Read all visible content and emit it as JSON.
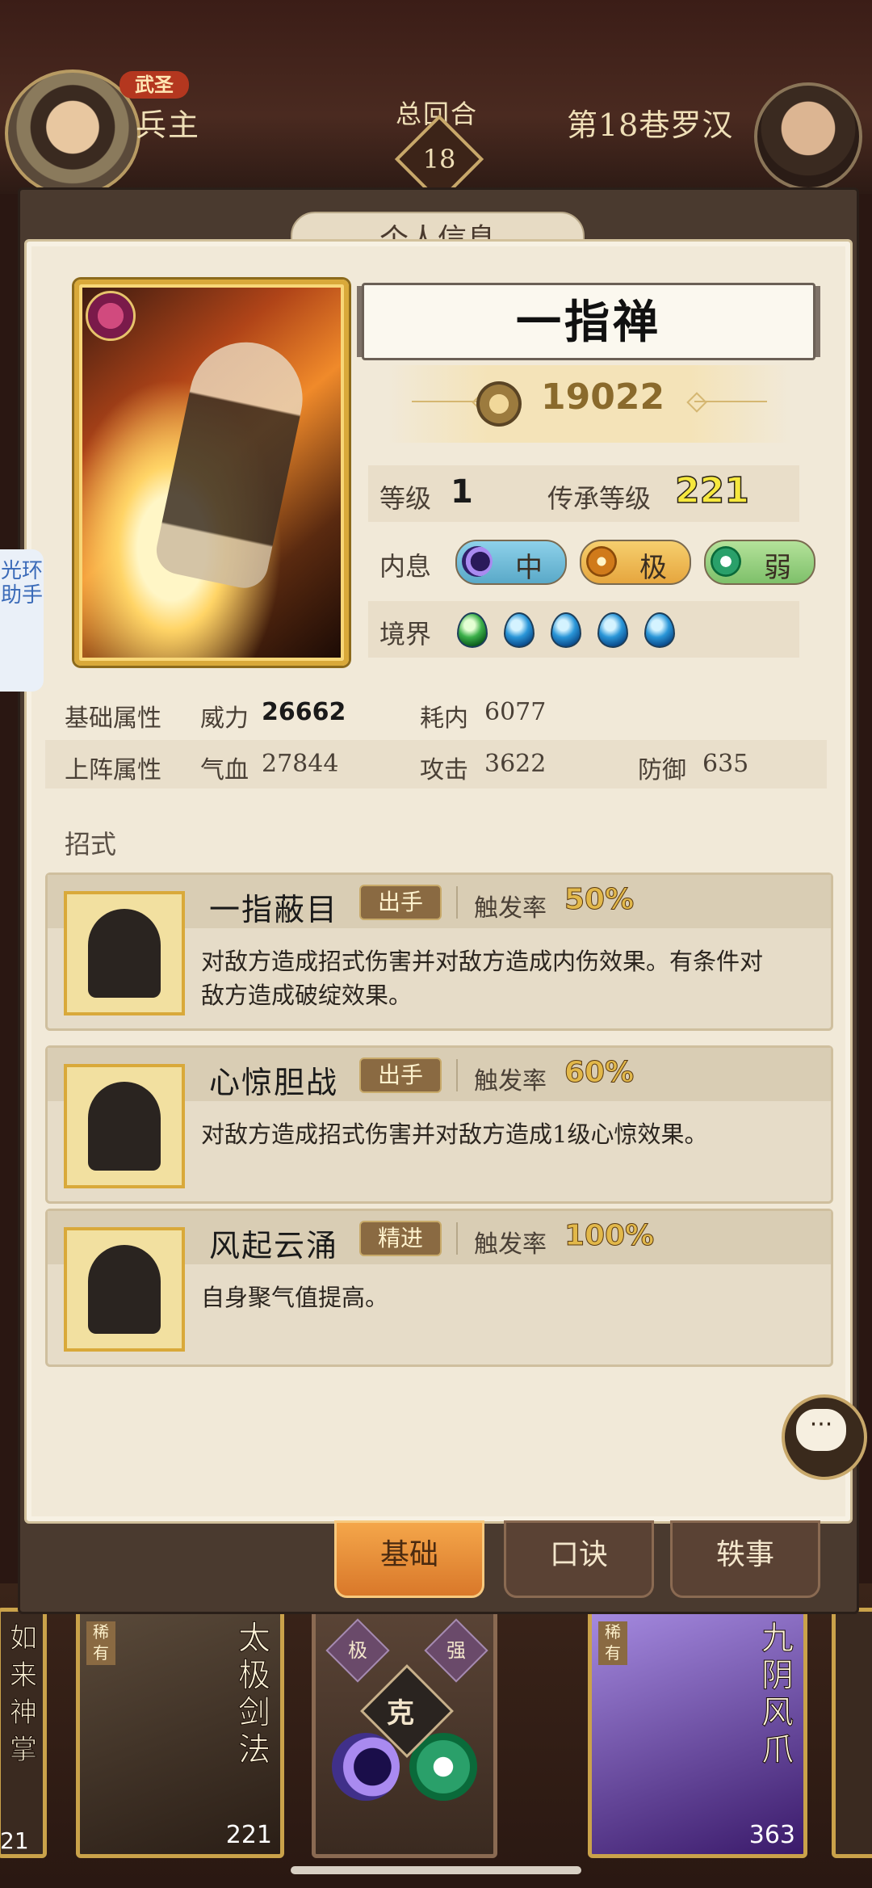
{
  "header": {
    "title_badge": "武圣",
    "player_name": "兵主",
    "round_label": "总回合",
    "round_number": "18",
    "enemy_name": "第18巷罗汉"
  },
  "panel": {
    "tab_label": "个人信息",
    "skill_name": "一指禅",
    "power": "19022",
    "level_label": "等级",
    "level_value": "1",
    "inherit_label": "传承等级",
    "inherit_value": "221",
    "neixi_label": "内息",
    "neixi": [
      {
        "label": "中",
        "color": "#8ed1ea"
      },
      {
        "label": "极",
        "color": "#f6cf6e"
      },
      {
        "label": "弱",
        "color": "#b4e29a"
      }
    ],
    "jingjie_label": "境界",
    "jingjie_count": 5
  },
  "attributes": {
    "basic_label": "基础属性",
    "weili_label": "威力",
    "weili_value": "26662",
    "haonei_label": "耗内",
    "haonei_value": "6077",
    "battle_label": "上阵属性",
    "qixue_label": "气血",
    "qixue_value": "27844",
    "gongji_label": "攻击",
    "gongji_value": "3622",
    "fangyu_label": "防御",
    "fangyu_value": "635"
  },
  "moves": {
    "title": "招式",
    "rate_label": "触发率",
    "items": [
      {
        "name": "一指蔽目",
        "tag": "出手",
        "rate": "50%",
        "desc": "对敌方造成招式伤害并对敌方造成内伤效果。有条件对敌方造成破绽效果。"
      },
      {
        "name": "心惊胆战",
        "tag": "出手",
        "rate": "60%",
        "desc": "对敌方造成招式伤害并对敌方造成1级心惊效果。"
      },
      {
        "name": "风起云涌",
        "tag": "精进",
        "rate": "100%",
        "desc": "自身聚气值提高。"
      }
    ]
  },
  "helper": {
    "label": "光环助手"
  },
  "bottom_tabs": {
    "basic": "基础",
    "koujue": "口诀",
    "yishi": "轶事"
  },
  "bottom_cards": {
    "left_level": "21",
    "taiji_title": "太极剑法",
    "taiji_tag": "稀有",
    "taiji_level": "221",
    "diamond_ji": "极",
    "diamond_qiang": "强",
    "ke": "克",
    "jiuyin_title": "九阴风爪",
    "jiuyin_tag": "稀有",
    "jiuyin_level": "363",
    "left_title": "如来神掌"
  }
}
